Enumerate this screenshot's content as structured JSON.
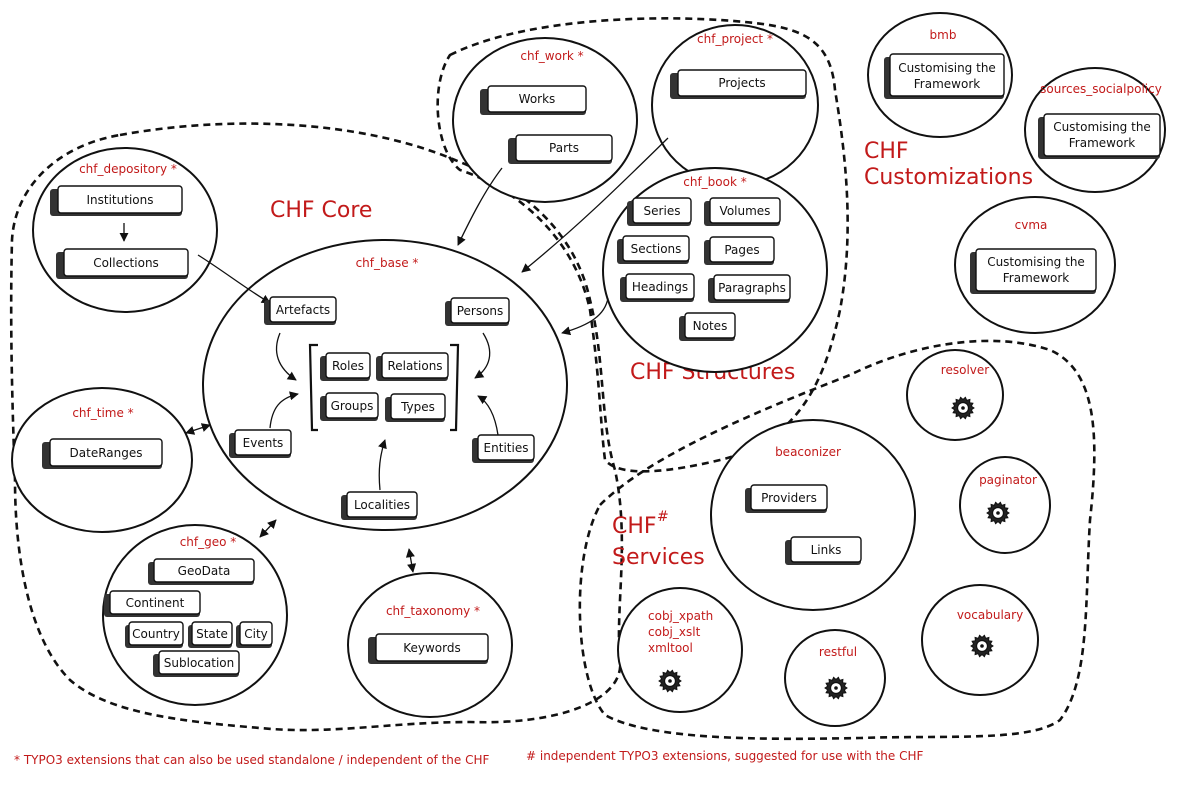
{
  "groups": {
    "core": "CHF Core",
    "structures": "CHF Structures",
    "customizations_line1": "CHF",
    "customizations_line2": "Customizations",
    "services_line1": "CHF",
    "services_sup": "#",
    "services_line2": "Services"
  },
  "modules": {
    "chf_depository": {
      "title": "chf_depository *",
      "items": [
        "Institutions",
        "Collections"
      ]
    },
    "chf_base": {
      "title": "chf_base *",
      "items": [
        "Artefacts",
        "Persons",
        "Roles",
        "Relations",
        "Groups",
        "Types",
        "Events",
        "Entities",
        "Localities"
      ]
    },
    "chf_time": {
      "title": "chf_time *",
      "items": [
        "DateRanges"
      ]
    },
    "chf_geo": {
      "title": "chf_geo *",
      "items": [
        "GeoData",
        "Continent",
        "Country",
        "State",
        "City",
        "Sublocation"
      ]
    },
    "chf_taxonomy": {
      "title": "chf_taxonomy *",
      "items": [
        "Keywords"
      ]
    },
    "chf_work": {
      "title": "chf_work *",
      "items": [
        "Works",
        "Parts"
      ]
    },
    "chf_project": {
      "title": "chf_project *",
      "items": [
        "Projects"
      ]
    },
    "chf_book": {
      "title": "chf_book *",
      "items": [
        "Series",
        "Volumes",
        "Sections",
        "Pages",
        "Headings",
        "Paragraphs",
        "Notes"
      ]
    },
    "bmb": {
      "title": "bmb",
      "items": [
        "Customising the",
        "Framework"
      ]
    },
    "sources_socialpolicy": {
      "title": "sources_socialpolicy",
      "items": [
        "Customising the",
        "Framework"
      ]
    },
    "cvma": {
      "title": "cvma",
      "items": [
        "Customising the",
        "Framework"
      ]
    },
    "resolver": {
      "title": "resolver"
    },
    "paginator": {
      "title": "paginator"
    },
    "beaconizer": {
      "title": "beaconizer",
      "items": [
        "Providers",
        "Links"
      ]
    },
    "vocabulary": {
      "title": "vocabulary"
    },
    "restful": {
      "title": "restful"
    },
    "cobj": {
      "title_lines": [
        "cobj_xpath",
        "cobj_xslt",
        "xmltool"
      ]
    }
  },
  "icons": {
    "service": "gear-icon"
  },
  "colors": {
    "title_red": "#c21a1a",
    "ink": "#111111"
  },
  "footnotes": {
    "standalone": "* TYPO3 extensions that can also be used standalone / independent of the CHF",
    "independent": "# independent TYPO3 extensions, suggested for use with the CHF"
  }
}
